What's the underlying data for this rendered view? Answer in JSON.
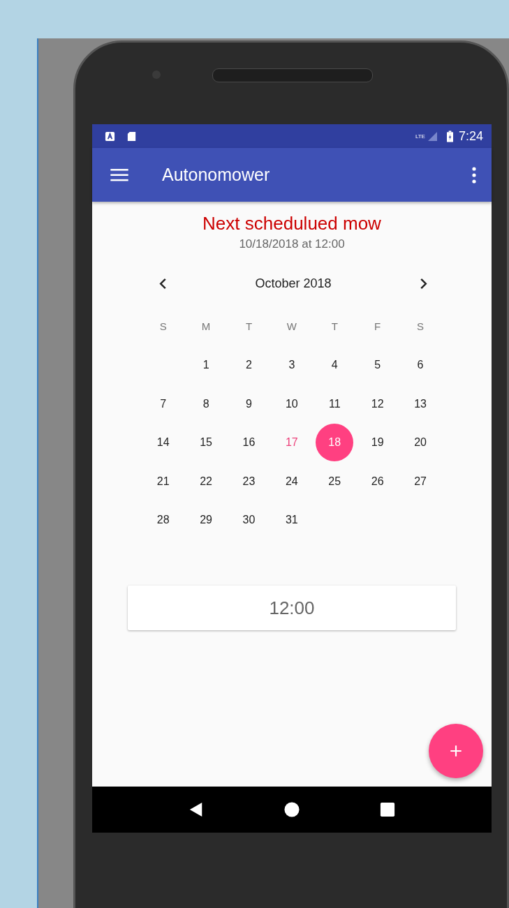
{
  "status_bar": {
    "time": "7:24",
    "network": "LTE"
  },
  "app_bar": {
    "title": "Autonomower"
  },
  "next_mow": {
    "heading": "Next schedulued mow",
    "when": "10/18/2018 at 12:00"
  },
  "calendar": {
    "month": "October 2018",
    "weekdays": [
      "S",
      "M",
      "T",
      "W",
      "T",
      "F",
      "S"
    ],
    "weeks": [
      [
        {
          "label": "1",
          "selected": false,
          "today": false
        },
        {
          "label": "2",
          "selected": false,
          "today": false
        },
        {
          "label": "3",
          "selected": false,
          "today": false
        },
        {
          "label": "4",
          "selected": false,
          "today": false
        },
        {
          "label": "5",
          "selected": false,
          "today": false
        },
        {
          "label": "6",
          "selected": false,
          "today": false
        }
      ],
      [
        {
          "label": "7",
          "selected": false,
          "today": false
        },
        {
          "label": "8",
          "selected": false,
          "today": false
        },
        {
          "label": "9",
          "selected": false,
          "today": false
        },
        {
          "label": "10",
          "selected": false,
          "today": false
        },
        {
          "label": "11",
          "selected": false,
          "today": false
        },
        {
          "label": "12",
          "selected": false,
          "today": false
        },
        {
          "label": "13",
          "selected": false,
          "today": false
        }
      ],
      [
        {
          "label": "14",
          "selected": false,
          "today": false
        },
        {
          "label": "15",
          "selected": false,
          "today": false
        },
        {
          "label": "16",
          "selected": false,
          "today": false
        },
        {
          "label": "17",
          "selected": false,
          "today": true
        },
        {
          "label": "18",
          "selected": true,
          "today": false
        },
        {
          "label": "19",
          "selected": false,
          "today": false
        },
        {
          "label": "20",
          "selected": false,
          "today": false
        }
      ],
      [
        {
          "label": "21",
          "selected": false,
          "today": false
        },
        {
          "label": "22",
          "selected": false,
          "today": false
        },
        {
          "label": "23",
          "selected": false,
          "today": false
        },
        {
          "label": "24",
          "selected": false,
          "today": false
        },
        {
          "label": "25",
          "selected": false,
          "today": false
        },
        {
          "label": "26",
          "selected": false,
          "today": false
        },
        {
          "label": "27",
          "selected": false,
          "today": false
        }
      ],
      [
        {
          "label": "28",
          "selected": false,
          "today": false
        },
        {
          "label": "29",
          "selected": false,
          "today": false
        },
        {
          "label": "30",
          "selected": false,
          "today": false
        },
        {
          "label": "31",
          "selected": false,
          "today": false
        }
      ]
    ]
  },
  "time_field": {
    "value": "12:00"
  }
}
